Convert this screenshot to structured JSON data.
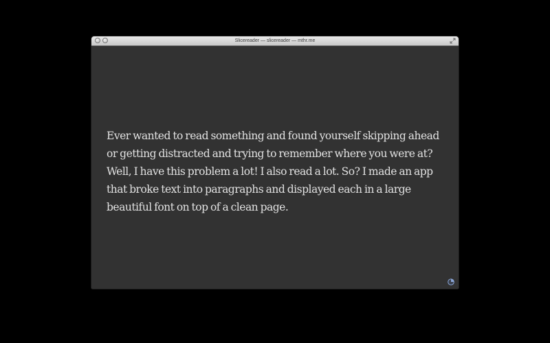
{
  "window": {
    "title": "Slicereader — slicereader — mthr.me"
  },
  "reader": {
    "paragraph": "Ever wanted to read something and found yourself skipping ahead or getting distracted and trying to remember where you were at? Well, I have this problem a lot! I also read a lot. So? I made an app that broke text into paragraphs and displayed each in a large beautiful font on top of a clean page.",
    "progress_fraction": 0.25
  },
  "colors": {
    "background": "#000000",
    "reader_background": "#323232",
    "text": "#e2e2e2",
    "progress_accent": "#8aa6d8"
  },
  "icons": {
    "close": "traffic-light-close",
    "minimize": "traffic-light-minimize",
    "fullscreen": "fullscreen-arrows",
    "progress": "pie-progress"
  }
}
